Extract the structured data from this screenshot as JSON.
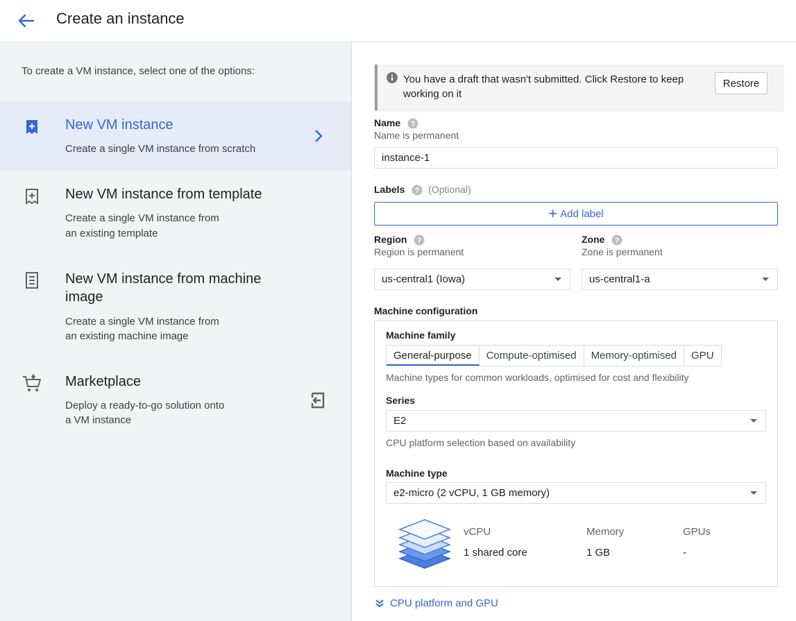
{
  "header": {
    "title": "Create an instance"
  },
  "left": {
    "intro": "To create a VM instance, select one of the options:",
    "options": [
      {
        "title": "New VM instance",
        "desc_lines": [
          "Create a single VM instance from scratch"
        ],
        "icon": "add-box-icon"
      },
      {
        "title": "New VM instance from template",
        "desc_lines": [
          "Create a single VM instance from",
          "an existing template"
        ],
        "icon": "template-icon"
      },
      {
        "title_lines": [
          "New VM instance from machine",
          "image"
        ],
        "desc_lines": [
          "Create a single VM instance from",
          "an existing machine image"
        ],
        "icon": "machine-image-icon"
      },
      {
        "title": "Marketplace",
        "desc_lines": [
          "Deploy a ready-to-go solution onto",
          "a VM instance"
        ],
        "icon": "cart-icon"
      }
    ]
  },
  "draft": {
    "text": "You have a draft that wasn't submitted. Click Restore to keep working on it",
    "restore_label": "Restore"
  },
  "form": {
    "name_label": "Name",
    "name_hint": "Name is permanent",
    "name_value": "instance-1",
    "labels_label": "Labels",
    "labels_optional": "(Optional)",
    "add_label": "Add label",
    "region_label": "Region",
    "region_hint": "Region is permanent",
    "region_value": "us-central1 (Iowa)",
    "zone_label": "Zone",
    "zone_hint": "Zone is permanent",
    "zone_value": "us-central1-a",
    "machine_config_label": "Machine configuration",
    "machine_family_label": "Machine family",
    "tabs": [
      "General-purpose",
      "Compute-optimised",
      "Memory-optimised",
      "GPU"
    ],
    "family_hint": "Machine types for common workloads, optimised for cost and flexibility",
    "series_label": "Series",
    "series_value": "E2",
    "series_hint": "CPU platform selection based on availability",
    "machine_type_label": "Machine type",
    "machine_type_value": "e2-micro (2 vCPU, 1 GB memory)",
    "specs": {
      "vcpu_label": "vCPU",
      "vcpu_value": "1 shared core",
      "memory_label": "Memory",
      "memory_value": "1 GB",
      "gpus_label": "GPUs",
      "gpus_value": "-"
    },
    "cpu_platform_link": "CPU platform and GPU"
  },
  "colors": {
    "accent": "#3367d6",
    "active_bg": "#e6ecf7",
    "panel_bg": "#f1f3f4"
  }
}
